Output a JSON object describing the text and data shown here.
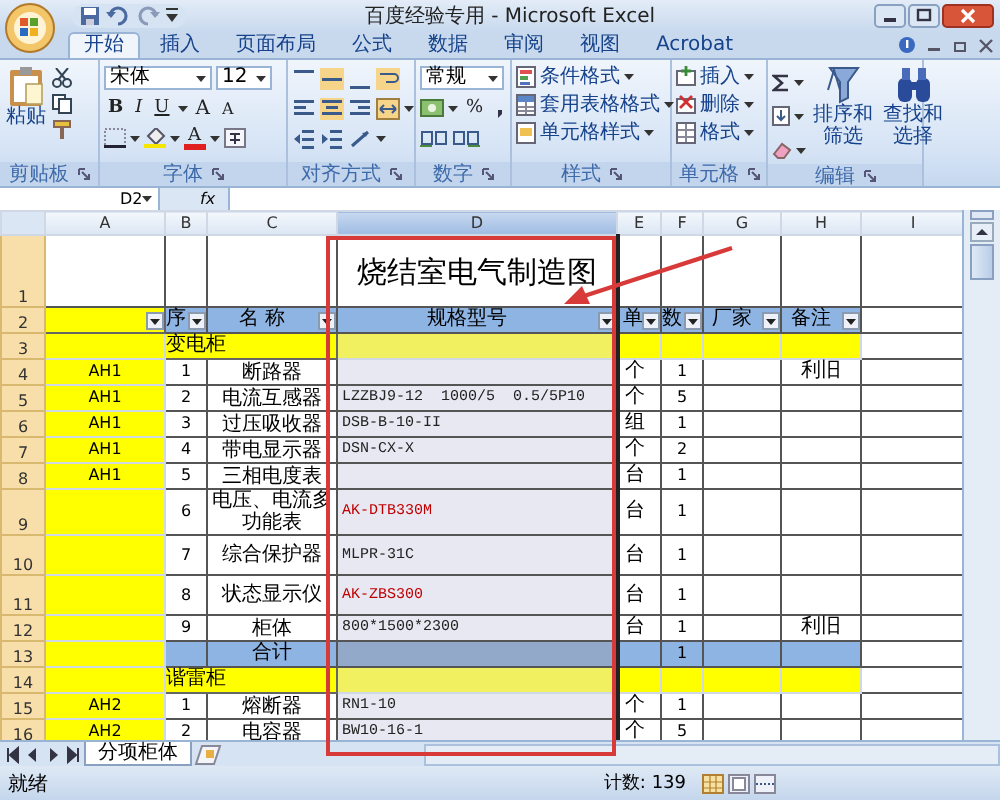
{
  "window": {
    "title": "百度经验专用 - Microsoft Excel"
  },
  "tabs": [
    {
      "label": "开始",
      "selected": true
    },
    {
      "label": "插入",
      "selected": false
    },
    {
      "label": "页面布局",
      "selected": false
    },
    {
      "label": "公式",
      "selected": false
    },
    {
      "label": "数据",
      "selected": false
    },
    {
      "label": "审阅",
      "selected": false
    },
    {
      "label": "视图",
      "selected": false
    },
    {
      "label": "Acrobat",
      "selected": false
    }
  ],
  "ribbon": {
    "clipboard": {
      "label": "剪贴板",
      "paste": "粘贴"
    },
    "font": {
      "label": "字体",
      "name": "宋体",
      "size": "12",
      "style_buttons": [
        "B",
        "I",
        "U"
      ],
      "size_buttons": [
        "A",
        "A"
      ],
      "color_button": "A"
    },
    "alignment": {
      "label": "对齐方式"
    },
    "number": {
      "label": "数字",
      "format": "常规",
      "percent": "%"
    },
    "styles": {
      "label": "样式",
      "commands": [
        "条件格式",
        "套用表格格式",
        "单元格样式"
      ]
    },
    "cells": {
      "label": "单元格",
      "commands": [
        "插入",
        "删除",
        "格式"
      ]
    },
    "editing": {
      "label": "编辑",
      "commands": [
        "排序和筛选",
        "查找和选择"
      ]
    }
  },
  "formula_bar": {
    "name_box": "D2",
    "fx": "fx"
  },
  "columns": [
    "A",
    "B",
    "C",
    "D",
    "E",
    "F",
    "G",
    "H",
    "I"
  ],
  "rows": [
    {
      "number": "1",
      "kind": "title",
      "title": "烧结室电气制造图"
    },
    {
      "number": "2",
      "kind": "header",
      "cells": [
        "序",
        "名 称",
        "规格型号",
        "单",
        "数",
        "厂家",
        "备注"
      ]
    },
    {
      "number": "3",
      "kind": "section",
      "label": "变电柜"
    },
    {
      "number": "4",
      "kind": "item",
      "cabinet": "AH1",
      "seq": "1",
      "name": "断路器",
      "unit": "个",
      "qty": "1",
      "note": "利旧"
    },
    {
      "number": "5",
      "kind": "item",
      "cabinet": "AH1",
      "seq": "2",
      "name": "电流互感器",
      "spec": "LZZBJ9-12  1000/5  0.5/5P10",
      "unit": "个",
      "qty": "5",
      "flagged": false
    },
    {
      "number": "6",
      "kind": "item",
      "cabinet": "AH1",
      "seq": "3",
      "name": "过压吸收器",
      "spec": "DSB-B-10-II",
      "unit": "组",
      "qty": "1",
      "flagged": false
    },
    {
      "number": "7",
      "kind": "item",
      "cabinet": "AH1",
      "seq": "4",
      "name": "带电显示器",
      "spec": "DSN-CX-X",
      "unit": "个",
      "qty": "2",
      "flagged": false
    },
    {
      "number": "8",
      "kind": "item",
      "cabinet": "AH1",
      "seq": "5",
      "name": "三相电度表",
      "unit": "台",
      "qty": "1"
    },
    {
      "number": "9",
      "kind": "item",
      "seq": "6",
      "name": "电压、电流多功能表",
      "spec": "AK-DTB330M",
      "unit": "台",
      "qty": "1",
      "flagged": true
    },
    {
      "number": "10",
      "kind": "item",
      "seq": "7",
      "name": "综合保护器",
      "spec": "MLPR-31C",
      "unit": "台",
      "qty": "1",
      "flagged": false
    },
    {
      "number": "11",
      "kind": "item",
      "seq": "8",
      "name": "状态显示仪",
      "spec": "AK-ZBS300",
      "unit": "台",
      "qty": "1",
      "flagged": true
    },
    {
      "number": "12",
      "kind": "item",
      "seq": "9",
      "name": "柜体",
      "spec": "800*1500*2300",
      "unit": "台",
      "qty": "1",
      "note": "利旧",
      "flagged": false
    },
    {
      "number": "13",
      "kind": "total",
      "name": "合计",
      "qty": "1"
    },
    {
      "number": "14",
      "kind": "section",
      "label": "谐雷柜"
    },
    {
      "number": "15",
      "kind": "item",
      "cabinet": "AH2",
      "seq": "1",
      "name": "熔断器",
      "spec": "RN1-10",
      "unit": "个",
      "qty": "1",
      "flagged": false
    },
    {
      "number": "16",
      "kind": "item",
      "cabinet": "AH2",
      "seq": "2",
      "name": "电容器",
      "spec": "BW10-16-1",
      "unit": "个",
      "qty": "5",
      "flagged": false
    }
  ],
  "sheet_tabs": [
    {
      "label": "分项柜体",
      "selected": true
    }
  ],
  "status_bar": {
    "state": "就绪",
    "count": "计数: 139"
  }
}
